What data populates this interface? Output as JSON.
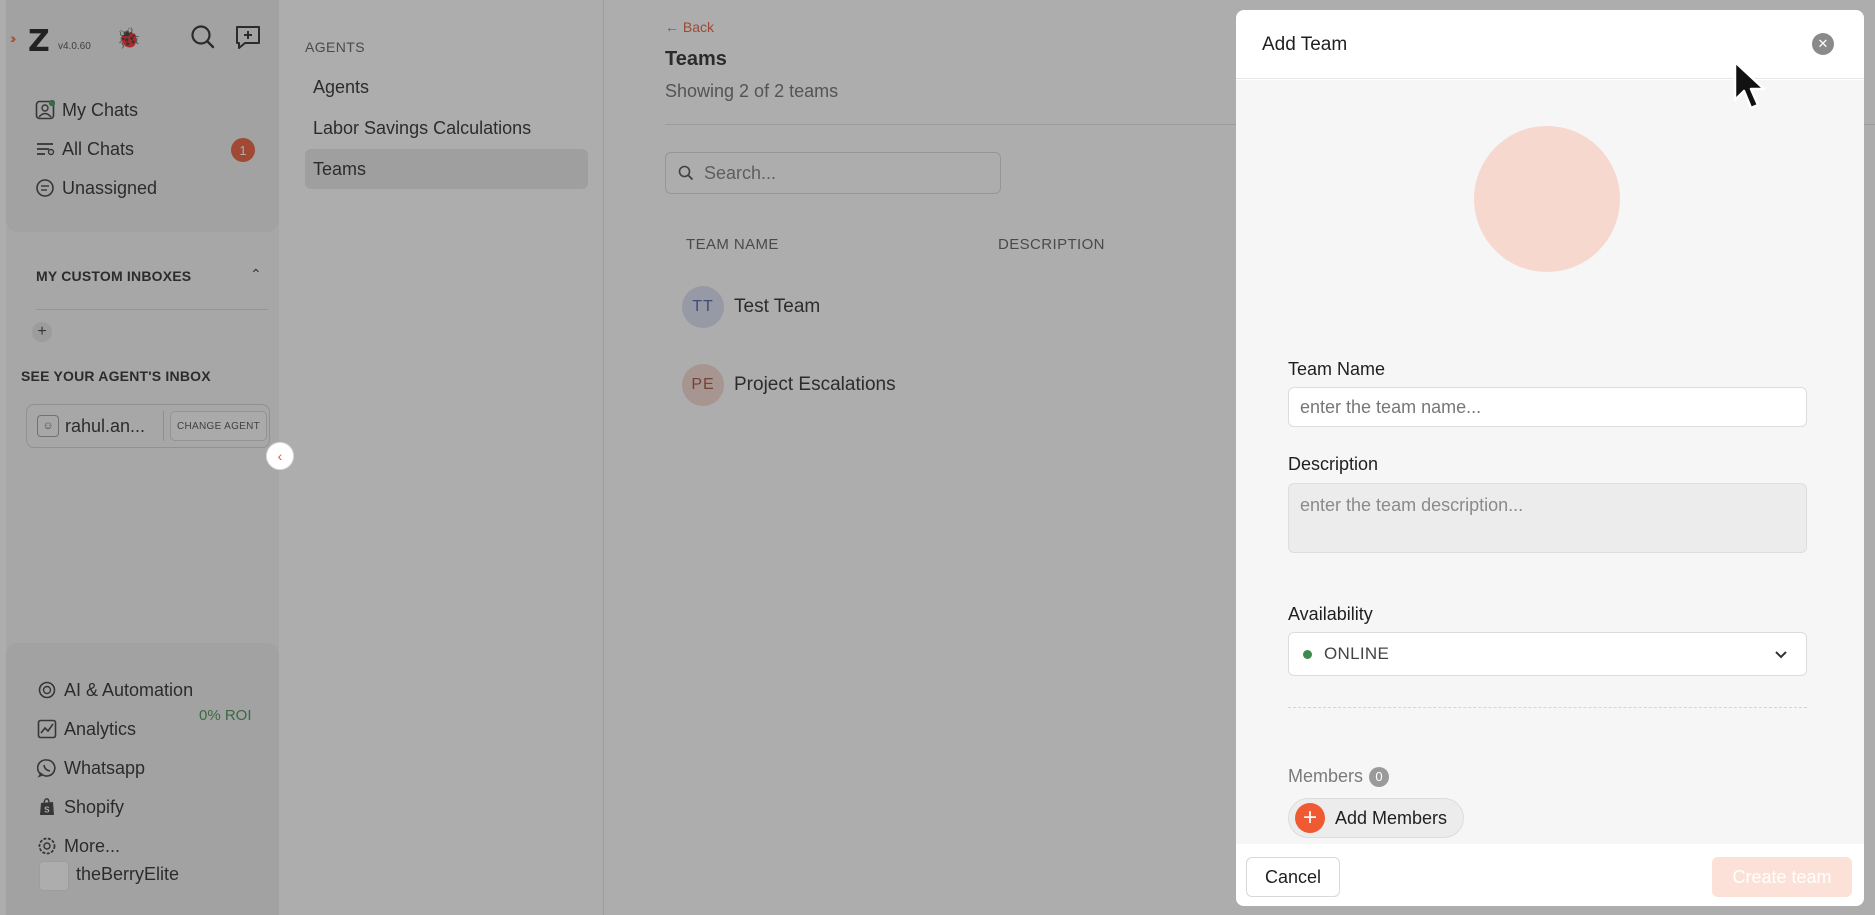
{
  "sidebar": {
    "version": "v4.0.60",
    "nav": [
      {
        "label": "My Chats"
      },
      {
        "label": "All Chats",
        "badge": "1"
      },
      {
        "label": "Unassigned"
      }
    ],
    "custom_inboxes_title": "MY CUSTOM INBOXES",
    "agent_inbox_title": "SEE YOUR AGENT'S INBOX",
    "agent_name": "rahul.an...",
    "change_agent_label": "CHANGE AGENT",
    "bottom_nav": [
      {
        "label": "AI & Automation"
      },
      {
        "label": "Analytics",
        "extra": "0% ROI"
      },
      {
        "label": "Whatsapp"
      },
      {
        "label": "Shopify"
      },
      {
        "label": "More..."
      }
    ],
    "store_name": "theBerryElite"
  },
  "submenu": {
    "title": "AGENTS",
    "items": [
      {
        "label": "Agents"
      },
      {
        "label": "Labor Savings Calculations"
      },
      {
        "label": "Teams"
      }
    ]
  },
  "main": {
    "back_label": "← Back",
    "title": "Teams",
    "subtitle": "Showing 2 of 2 teams",
    "search_placeholder": "Search...",
    "columns": [
      "TEAM NAME",
      "DESCRIPTION"
    ],
    "teams": [
      {
        "initials": "TT",
        "name": "Test Team",
        "color": "#d9dff0",
        "text_color": "#3e5a9a"
      },
      {
        "initials": "PE",
        "name": "Project Escalations",
        "color": "#f3d6cd",
        "text_color": "#9a4a35"
      }
    ]
  },
  "drawer": {
    "title": "Add Team",
    "team_name_label": "Team Name",
    "team_name_placeholder": "enter the team name...",
    "description_label": "Description",
    "description_placeholder": "enter the team description...",
    "availability_label": "Availability",
    "availability_value": "ONLINE",
    "members_label": "Members",
    "members_count": "0",
    "add_members_label": "Add Members",
    "cancel_label": "Cancel",
    "create_label": "Create team"
  },
  "colors": {
    "accent": "#e8532f",
    "online": "#3d8b4d"
  }
}
